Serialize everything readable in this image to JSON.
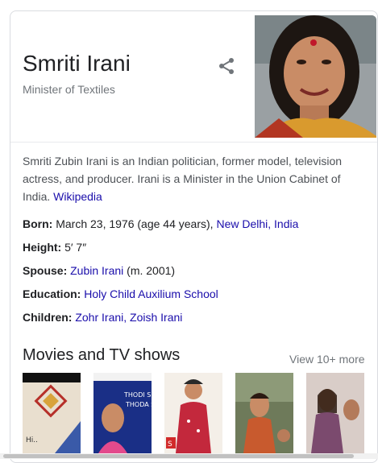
{
  "knowledge_panel": {
    "title": "Smriti Irani",
    "subtitle": "Minister of Textiles",
    "share_icon": "share-icon",
    "description_text": "Smriti Zubin Irani is an Indian politician, former model, television actress, and producer. Irani is a Minister in the Union Cabinet of India.",
    "description_link": "Wikipedia",
    "facts": [
      {
        "label": "Born:",
        "text": "March 23, 1976 (age 44 years),",
        "link": "New Delhi, India"
      },
      {
        "label": "Height:",
        "text": "5′ 7″",
        "link": ""
      },
      {
        "label": "Spouse:",
        "text": "(m. 2001)",
        "link": "Zubin Irani",
        "link_first": true
      },
      {
        "label": "Education:",
        "text": "",
        "link": "Holy Child Auxilium School"
      },
      {
        "label": "Children:",
        "text": "",
        "link": "Zohr Irani, Zoish Irani"
      }
    ],
    "movies_section": {
      "title": "Movies and TV shows",
      "more_label": "View 10+ more",
      "thumb2_text_line1": "THODI SI",
      "thumb2_text_line2": "THODA SA"
    }
  },
  "colors": {
    "link": "#1a0dab",
    "muted": "#70757a",
    "text": "#202124"
  }
}
